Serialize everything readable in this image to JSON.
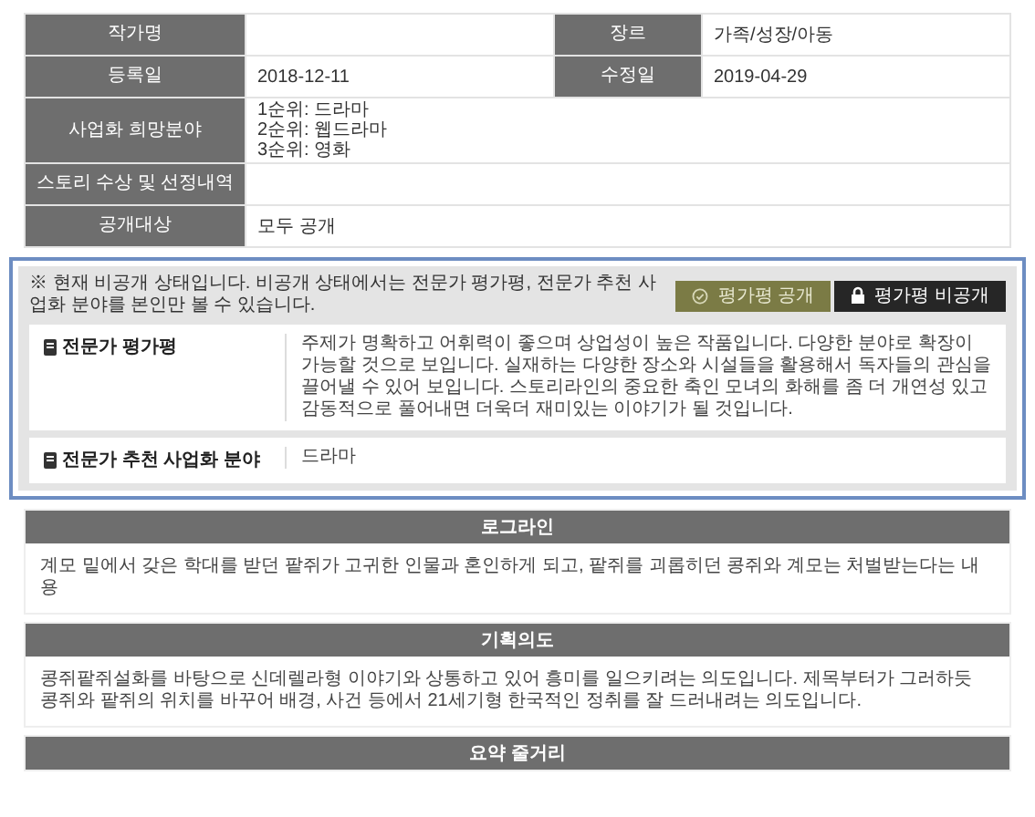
{
  "info_table": {
    "rows": [
      {
        "cells": [
          {
            "label": "작가명"
          },
          {
            "label": "장르",
            "value": [
              "가족/성장/아동"
            ]
          }
        ]
      },
      {
        "cells": [
          {
            "label": "등록일",
            "value": [
              "2018-12-11"
            ]
          },
          {
            "label": "수정일",
            "value": [
              "2019-04-29"
            ]
          }
        ]
      },
      {
        "cells": [
          {
            "label": "사업화 희망분야",
            "value": [
              "1순위: 드라마",
              "2순위: 웹드라마",
              "3순위: 영화"
            ]
          }
        ]
      },
      {
        "cells": [
          {
            "label": "스토리 수상 및 선정내역"
          }
        ]
      },
      {
        "cells": [
          {
            "label": "공개대상",
            "value": [
              "모두 공개"
            ]
          }
        ]
      }
    ]
  },
  "expert": {
    "notice": "※ 현재 비공개 상태입니다. 비공개 상태에서는 전문가 평가평, 전문가 추천 사업화 분야를 본인만 볼 수 있습니다.",
    "buttons": [
      {
        "label": "평가평 공개",
        "kind": "check",
        "selected": false
      },
      {
        "label": "평가평 비공개",
        "kind": "lock",
        "selected": true
      }
    ],
    "cards": [
      {
        "title": "전문가 평가평",
        "text": "주제가 명확하고 어휘력이 좋으며 상업성이 높은 작품입니다. 다양한 분야로 확장이 가능할 것으로 보입니다. 실재하는 다양한 장소와 시설들을 활용해서 독자들의 관심을 끌어낼 수 있어 보입니다. 스토리라인의 중요한 축인 모녀의 화해를 좀 더 개연성 있고 감동적으로 풀어내면 더욱더 재미있는 이야기가 될 것입니다."
      },
      {
        "title": "전문가 추천 사업화 분야",
        "text": "드라마"
      }
    ]
  },
  "sections": [
    {
      "title": "로그라인",
      "text": "계모 밑에서 갖은 학대를 받던 팥쥐가 고귀한 인물과 혼인하게 되고, 팥쥐를 괴롭히던 콩쥐와 계모는 처벌받는다는 내용"
    },
    {
      "title": "기획의도",
      "text": "콩쥐팥쥐설화를 바탕으로 신데렐라형 이야기와 상통하고 있어 흥미를 일으키려는 의도입니다. 제목부터가 그러하듯 콩쥐와 팥쥐의 위치를 바꾸어 배경, 사건 등에서 21세기형 한국적인 정취를 잘 드러내려는 의도입니다."
    },
    {
      "title": "요약 줄거리"
    }
  ]
}
